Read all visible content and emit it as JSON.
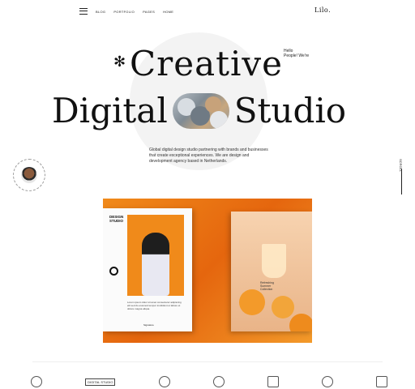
{
  "nav": {
    "items": [
      "BLOG",
      "PORTFOLIO",
      "PAGES",
      "HOME"
    ]
  },
  "logo": "Lilo.",
  "hero": {
    "hello": "Hello\nPeople! We're",
    "creative": "Creative",
    "digital": "Digital",
    "studio": "Studio",
    "description": "Global digital design studio partnering with brands and businesses that create exceptional experiences. We are design and development agency based in Netherlands."
  },
  "scroll_label": "SCROLL",
  "showcase": {
    "left_title": "DESIGN\nSTUDIO",
    "left_body": "Lorem ipsum dolor sit amet consectetur adipiscing elit sed do eiusmod tempor incididunt ut labore et dolore magna aliqua.",
    "left_signature": "Signature",
    "right_text": "Refreshing\nSummer\nCollection"
  },
  "bottom": {
    "tag_label": "DIGITAL STUDIO"
  },
  "colors": {
    "accent": "#f08a1a",
    "text": "#111111",
    "blob": "#f3f3f3"
  }
}
